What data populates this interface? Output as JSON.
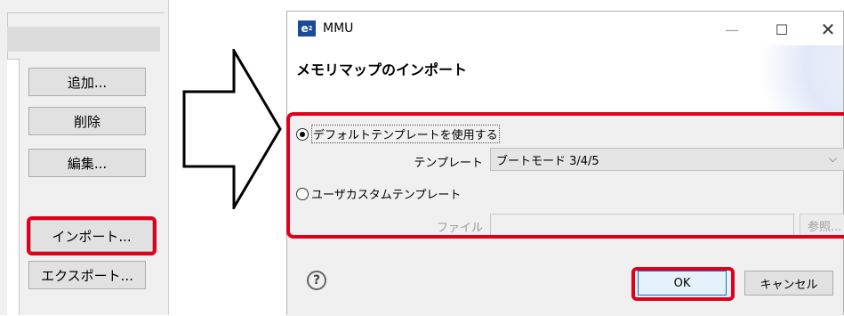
{
  "left_panel": {
    "buttons": {
      "add": "追加...",
      "delete": "削除",
      "edit": "編集...",
      "import": "インポート...",
      "export": "エクスポート..."
    }
  },
  "dialog": {
    "app_logo": "e",
    "app_logo_sup": "2",
    "title": "MMU",
    "controls": {
      "minimize": "—",
      "maximize": "☐",
      "close": "✕"
    },
    "heading": "メモリマップのインポート",
    "options": {
      "default_template_label": "デフォルトテンプレートを使用する",
      "default_template_checked": true,
      "template_field_label": "テンプレート",
      "template_value": "ブートモード 3/4/5",
      "custom_template_label": "ユーザカスタムテンプレート",
      "custom_template_checked": false,
      "file_field_label": "ファイル",
      "file_value": "",
      "browse_label": "参照..."
    },
    "help_label": "?",
    "ok_label": "OK",
    "cancel_label": "キャンセル"
  },
  "icons": {
    "select_chevron": "chevron-down-icon",
    "help": "help-icon",
    "arrow": "right-arrow-icon"
  },
  "colors": {
    "highlight": "#e0001b",
    "logo_bg": "#1a4b96",
    "ok_border": "#0078d7"
  }
}
